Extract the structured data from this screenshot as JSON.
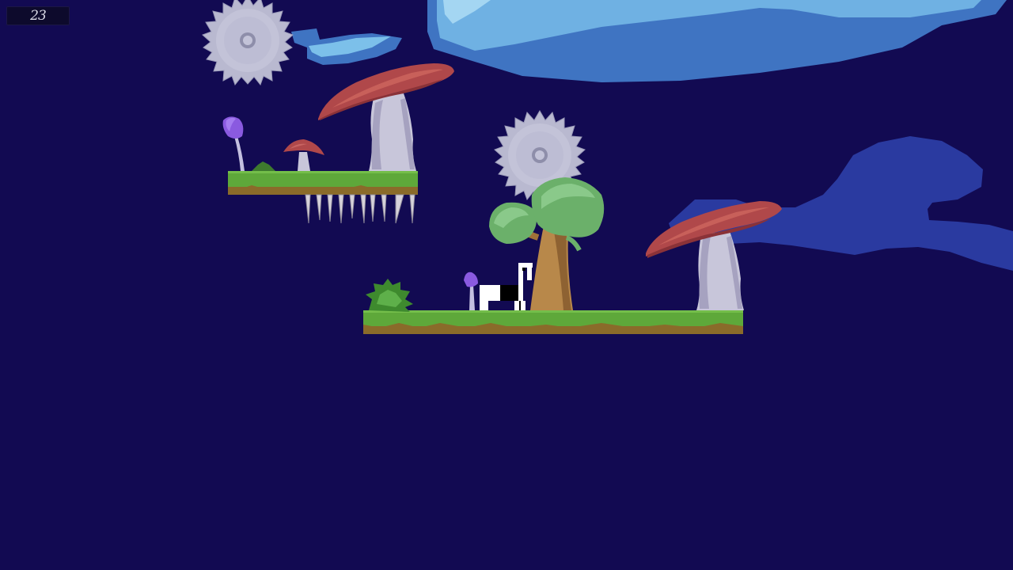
{
  "hud": {
    "counter": "23"
  },
  "colors": {
    "sky": "#120a52",
    "cloud_light": "#74b6e4",
    "cloud_mid": "#4f8dd0",
    "cloud_dark": "#2a3aa0",
    "grass": "#5ea83a",
    "dirt": "#8a6b2a",
    "mushroom_cap": "#b0484a",
    "mushroom_stem": "#c8c6da",
    "saw": "#b9b9d0",
    "tree_trunk": "#b8884a",
    "tree_foliage": "#6bb06a",
    "bush": "#4a9a3a",
    "small_mushroom": "#8a5ae0",
    "player_white": "#ffffff",
    "player_black": "#000000"
  },
  "scene": {
    "objects": [
      "saw-blade-upper",
      "saw-blade-middle",
      "upper-grass-platform",
      "lower-grass-platform",
      "hanging-spikes",
      "giant-red-mushroom-left",
      "giant-red-mushroom-right",
      "small-red-mushroom",
      "purple-mushroom-upper",
      "purple-mushroom-lower",
      "green-tree",
      "green-bush",
      "player-dog"
    ]
  }
}
